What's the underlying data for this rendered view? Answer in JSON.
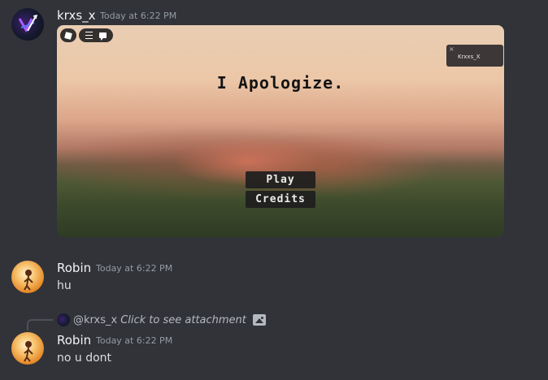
{
  "messages": [
    {
      "username": "krxs_x",
      "timestamp": "Today at 6:22 PM",
      "attachment": {
        "title": "I Apologize.",
        "buttons": [
          "Play",
          "Credits"
        ],
        "player_panel_name": "Krxxs_X"
      }
    },
    {
      "username": "Robin",
      "timestamp": "Today at 6:22 PM",
      "text": "hu"
    },
    {
      "reply": {
        "mention": "@krxs_x",
        "text": "Click to see attachment"
      },
      "username": "Robin",
      "timestamp": "Today at 6:22 PM",
      "text": "no u dont"
    }
  ]
}
